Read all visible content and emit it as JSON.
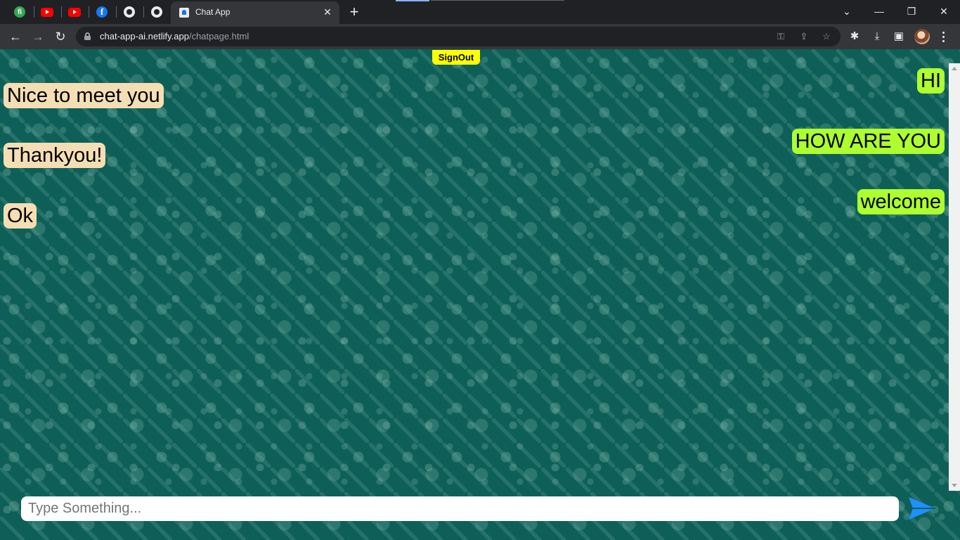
{
  "browser": {
    "active_tab": {
      "title": "Chat App",
      "close": "✕"
    },
    "new_tab": "+",
    "url": {
      "host": "chat-app-ai.netlify.app",
      "path": "/chatpage.html"
    },
    "window_controls": {
      "minimize": "—",
      "restore": "❐",
      "close": "✕",
      "tab_search": "⌄"
    },
    "nav": {
      "back": "←",
      "forward": "→",
      "reload": "↻"
    },
    "pinned_tabs": [
      {
        "icon": "fh-icon",
        "glyph": "fi"
      },
      {
        "icon": "youtube-icon",
        "glyph": ""
      },
      {
        "icon": "youtube-icon",
        "glyph": ""
      },
      {
        "icon": "facebook-icon",
        "glyph": "f"
      },
      {
        "icon": "globe-icon",
        "glyph": ""
      },
      {
        "icon": "globe-icon",
        "glyph": ""
      }
    ],
    "toolbar_icons": {
      "key": "⚿",
      "share": "⇪",
      "star": "☆",
      "extensions": "✱",
      "download": "⤓",
      "sidepanel": "▣"
    }
  },
  "page": {
    "signout_label": "SignOut",
    "messages_received": [
      {
        "text": "Nice to meet you"
      },
      {
        "text": "Thankyou!"
      },
      {
        "text": "Ok"
      }
    ],
    "messages_sent": [
      {
        "text": "HI"
      },
      {
        "text": "HOW ARE YOU"
      },
      {
        "text": "welcome"
      }
    ],
    "composer": {
      "placeholder": "Type Something...",
      "value": ""
    },
    "colors": {
      "received_bubble": "#f5deb3",
      "sent_bubble": "#adff2f",
      "signout": "#ffff00",
      "background": "#0e5f57",
      "send_icon": "#1e90ff"
    }
  }
}
